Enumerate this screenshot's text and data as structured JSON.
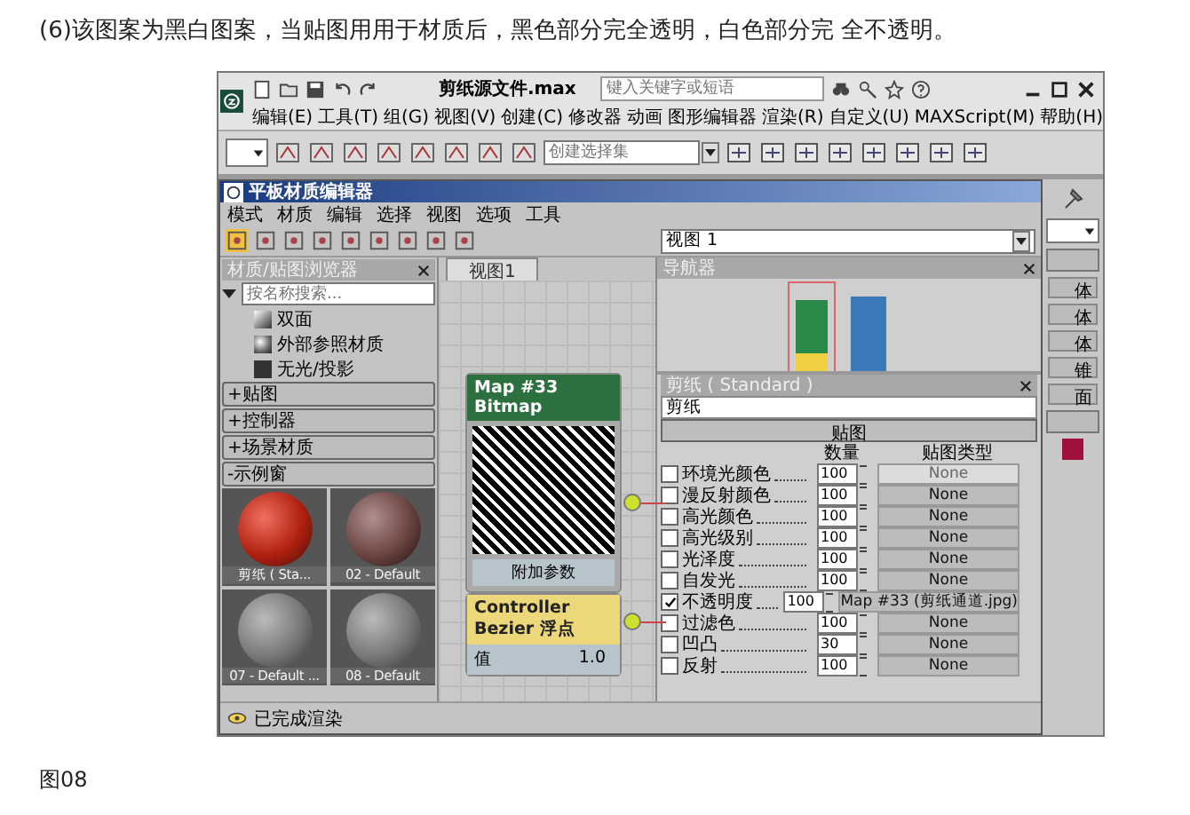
{
  "caption": "(6)该图案为黑白图案，当贴图用用于材质后，黑色部分完全透明，白色部分完 全不透明。",
  "window": {
    "title": "剪纸源文件.max",
    "search": {
      "placeholder": "键入关键字或短语"
    }
  },
  "menu": [
    "编辑(E)",
    "工具(T)",
    "组(G)",
    "视图(V)",
    "创建(C)",
    "修改器",
    "动画",
    "图形编辑器",
    "渲染(R)",
    "自定义(U)",
    "MAXScript(M)",
    "帮助(H)"
  ],
  "toolbar": {
    "selection_set": {
      "placeholder": "创建选择集"
    }
  },
  "slate": {
    "title": "平板材质编辑器",
    "menu": [
      "模式",
      "材质",
      "编辑",
      "选择",
      "视图",
      "选项",
      "工具"
    ],
    "viewport_select": "视图 1",
    "browser": {
      "title": "材质/贴图浏览器",
      "search": {
        "placeholder": "按名称搜索..."
      },
      "items": [
        {
          "label": "双面",
          "kind": "shaded"
        },
        {
          "label": "外部参照材质",
          "kind": "sphere"
        },
        {
          "label": "无光/投影",
          "kind": "dark"
        }
      ],
      "groups": [
        "+贴图",
        "+控制器",
        "+场景材质",
        "-示例窗"
      ],
      "samples": [
        {
          "label": "剪纸 ( Sta...",
          "kind": "red"
        },
        {
          "label": "02 - Default",
          "kind": "brown"
        },
        {
          "label": "07 - Default ...",
          "kind": "grey"
        },
        {
          "label": "08 - Default",
          "kind": "grey"
        }
      ]
    },
    "view": {
      "tabs": [
        {
          "label": "视图1",
          "selected": true
        }
      ],
      "map_node": {
        "title": "Map #33",
        "subtitle": "Bitmap",
        "footer": "附加参数"
      },
      "controller_node": {
        "title": "Controller",
        "subtitle": "Bezier 浮点",
        "param": "值",
        "value": "1.0"
      }
    },
    "navigator": {
      "title": "导航器"
    },
    "params": {
      "title": "剪纸 ( Standard )",
      "name": "剪纸",
      "rollout": "贴图",
      "columns": [
        "数量",
        "贴图类型"
      ],
      "rows": [
        {
          "label": "环境光颜色",
          "checked": false,
          "amount": "100",
          "map": "None",
          "disabled": true
        },
        {
          "label": "漫反射颜色",
          "checked": false,
          "amount": "100",
          "map": "None",
          "disabled": false
        },
        {
          "label": "高光颜色",
          "checked": false,
          "amount": "100",
          "map": "None",
          "disabled": false
        },
        {
          "label": "高光级别",
          "checked": false,
          "amount": "100",
          "map": "None",
          "disabled": false
        },
        {
          "label": "光泽度",
          "checked": false,
          "amount": "100",
          "map": "None",
          "disabled": false
        },
        {
          "label": "自发光",
          "checked": false,
          "amount": "100",
          "map": "None",
          "disabled": false
        },
        {
          "label": "不透明度",
          "checked": true,
          "amount": "100",
          "map": "Map #33 (剪纸通道.jpg)",
          "disabled": false
        },
        {
          "label": "过滤色",
          "checked": false,
          "amount": "100",
          "map": "None",
          "disabled": false
        },
        {
          "label": "凹凸",
          "checked": false,
          "amount": "30",
          "map": "None",
          "disabled": false
        },
        {
          "label": "反射",
          "checked": false,
          "amount": "100",
          "map": "None",
          "disabled": false
        }
      ]
    },
    "status": "已完成渲染"
  },
  "command_panel": {
    "buttons": [
      "体",
      "体",
      "体",
      "锥",
      "面"
    ],
    "swatch": {
      "color": "#a0103a"
    }
  },
  "figure_label": "图08"
}
